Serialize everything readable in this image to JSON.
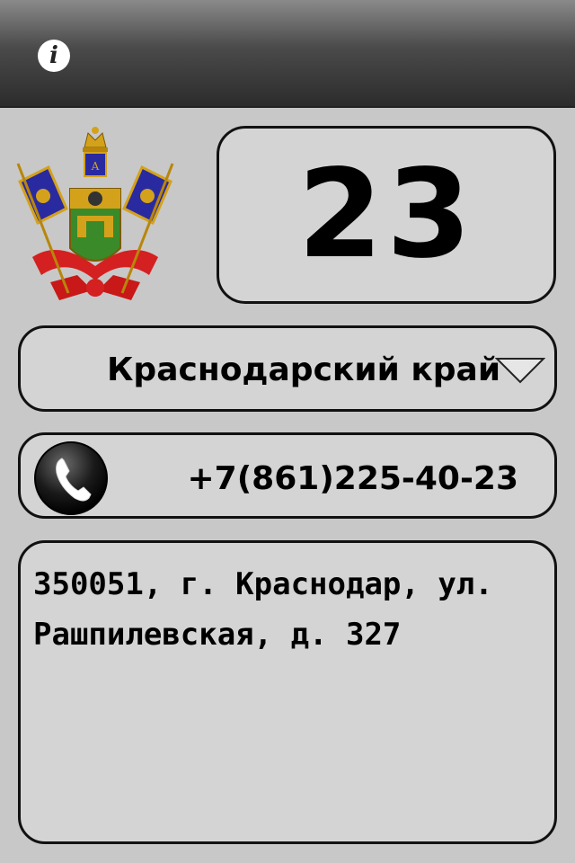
{
  "header": {
    "info_icon": "info-icon",
    "info_glyph": "i"
  },
  "region": {
    "code": "23",
    "name": "Краснодарский край",
    "emblem_icon": "coat-of-arms-icon",
    "dropdown_icon": "chevron-down-icon"
  },
  "contact": {
    "phone": "+7(861)225-40-23",
    "phone_icon": "phone-icon",
    "address": "350051, г. Краснодар, ул. Рашпилевская, д. 327"
  },
  "colors": {
    "background": "#c8c8c8",
    "box_fill": "#d4d4d4",
    "border": "#111111"
  }
}
